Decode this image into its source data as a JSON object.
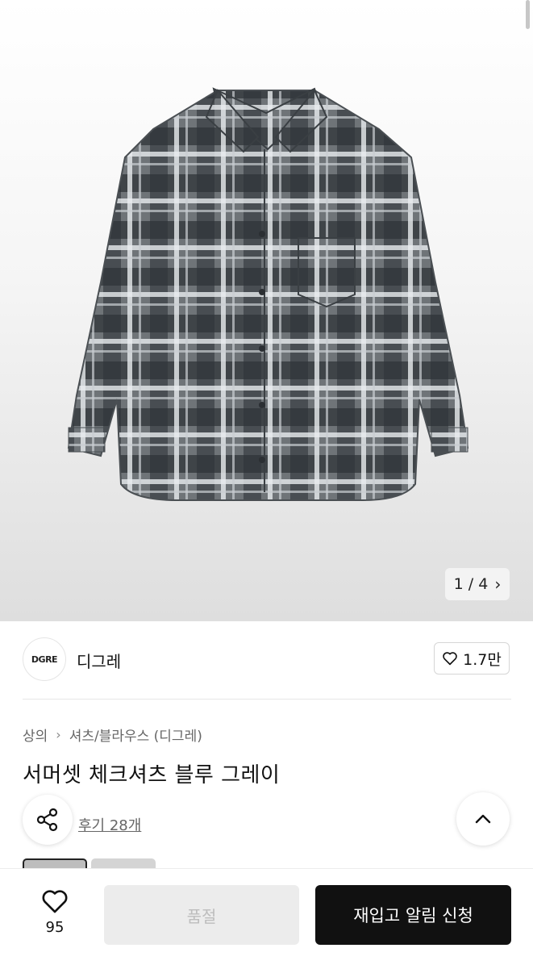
{
  "gallery": {
    "counter": "1 / 4"
  },
  "brand": {
    "logo_text": "DGRE",
    "name": "디그레",
    "likes": "1.7만"
  },
  "breadcrumb": {
    "category": "상의",
    "subcategory": "셔츠/블라우스 (디그레)"
  },
  "product": {
    "title": "서머셋 체크셔츠 블루 그레이",
    "reviews": "후기 28개"
  },
  "bottom_bar": {
    "wish_count": "95",
    "soldout_label": "품절",
    "restock_label": "재입고 알림 신청"
  },
  "colors": {
    "accent": "#111111",
    "disabled_bg": "#ececec",
    "disabled_text": "#bdbdbd"
  }
}
